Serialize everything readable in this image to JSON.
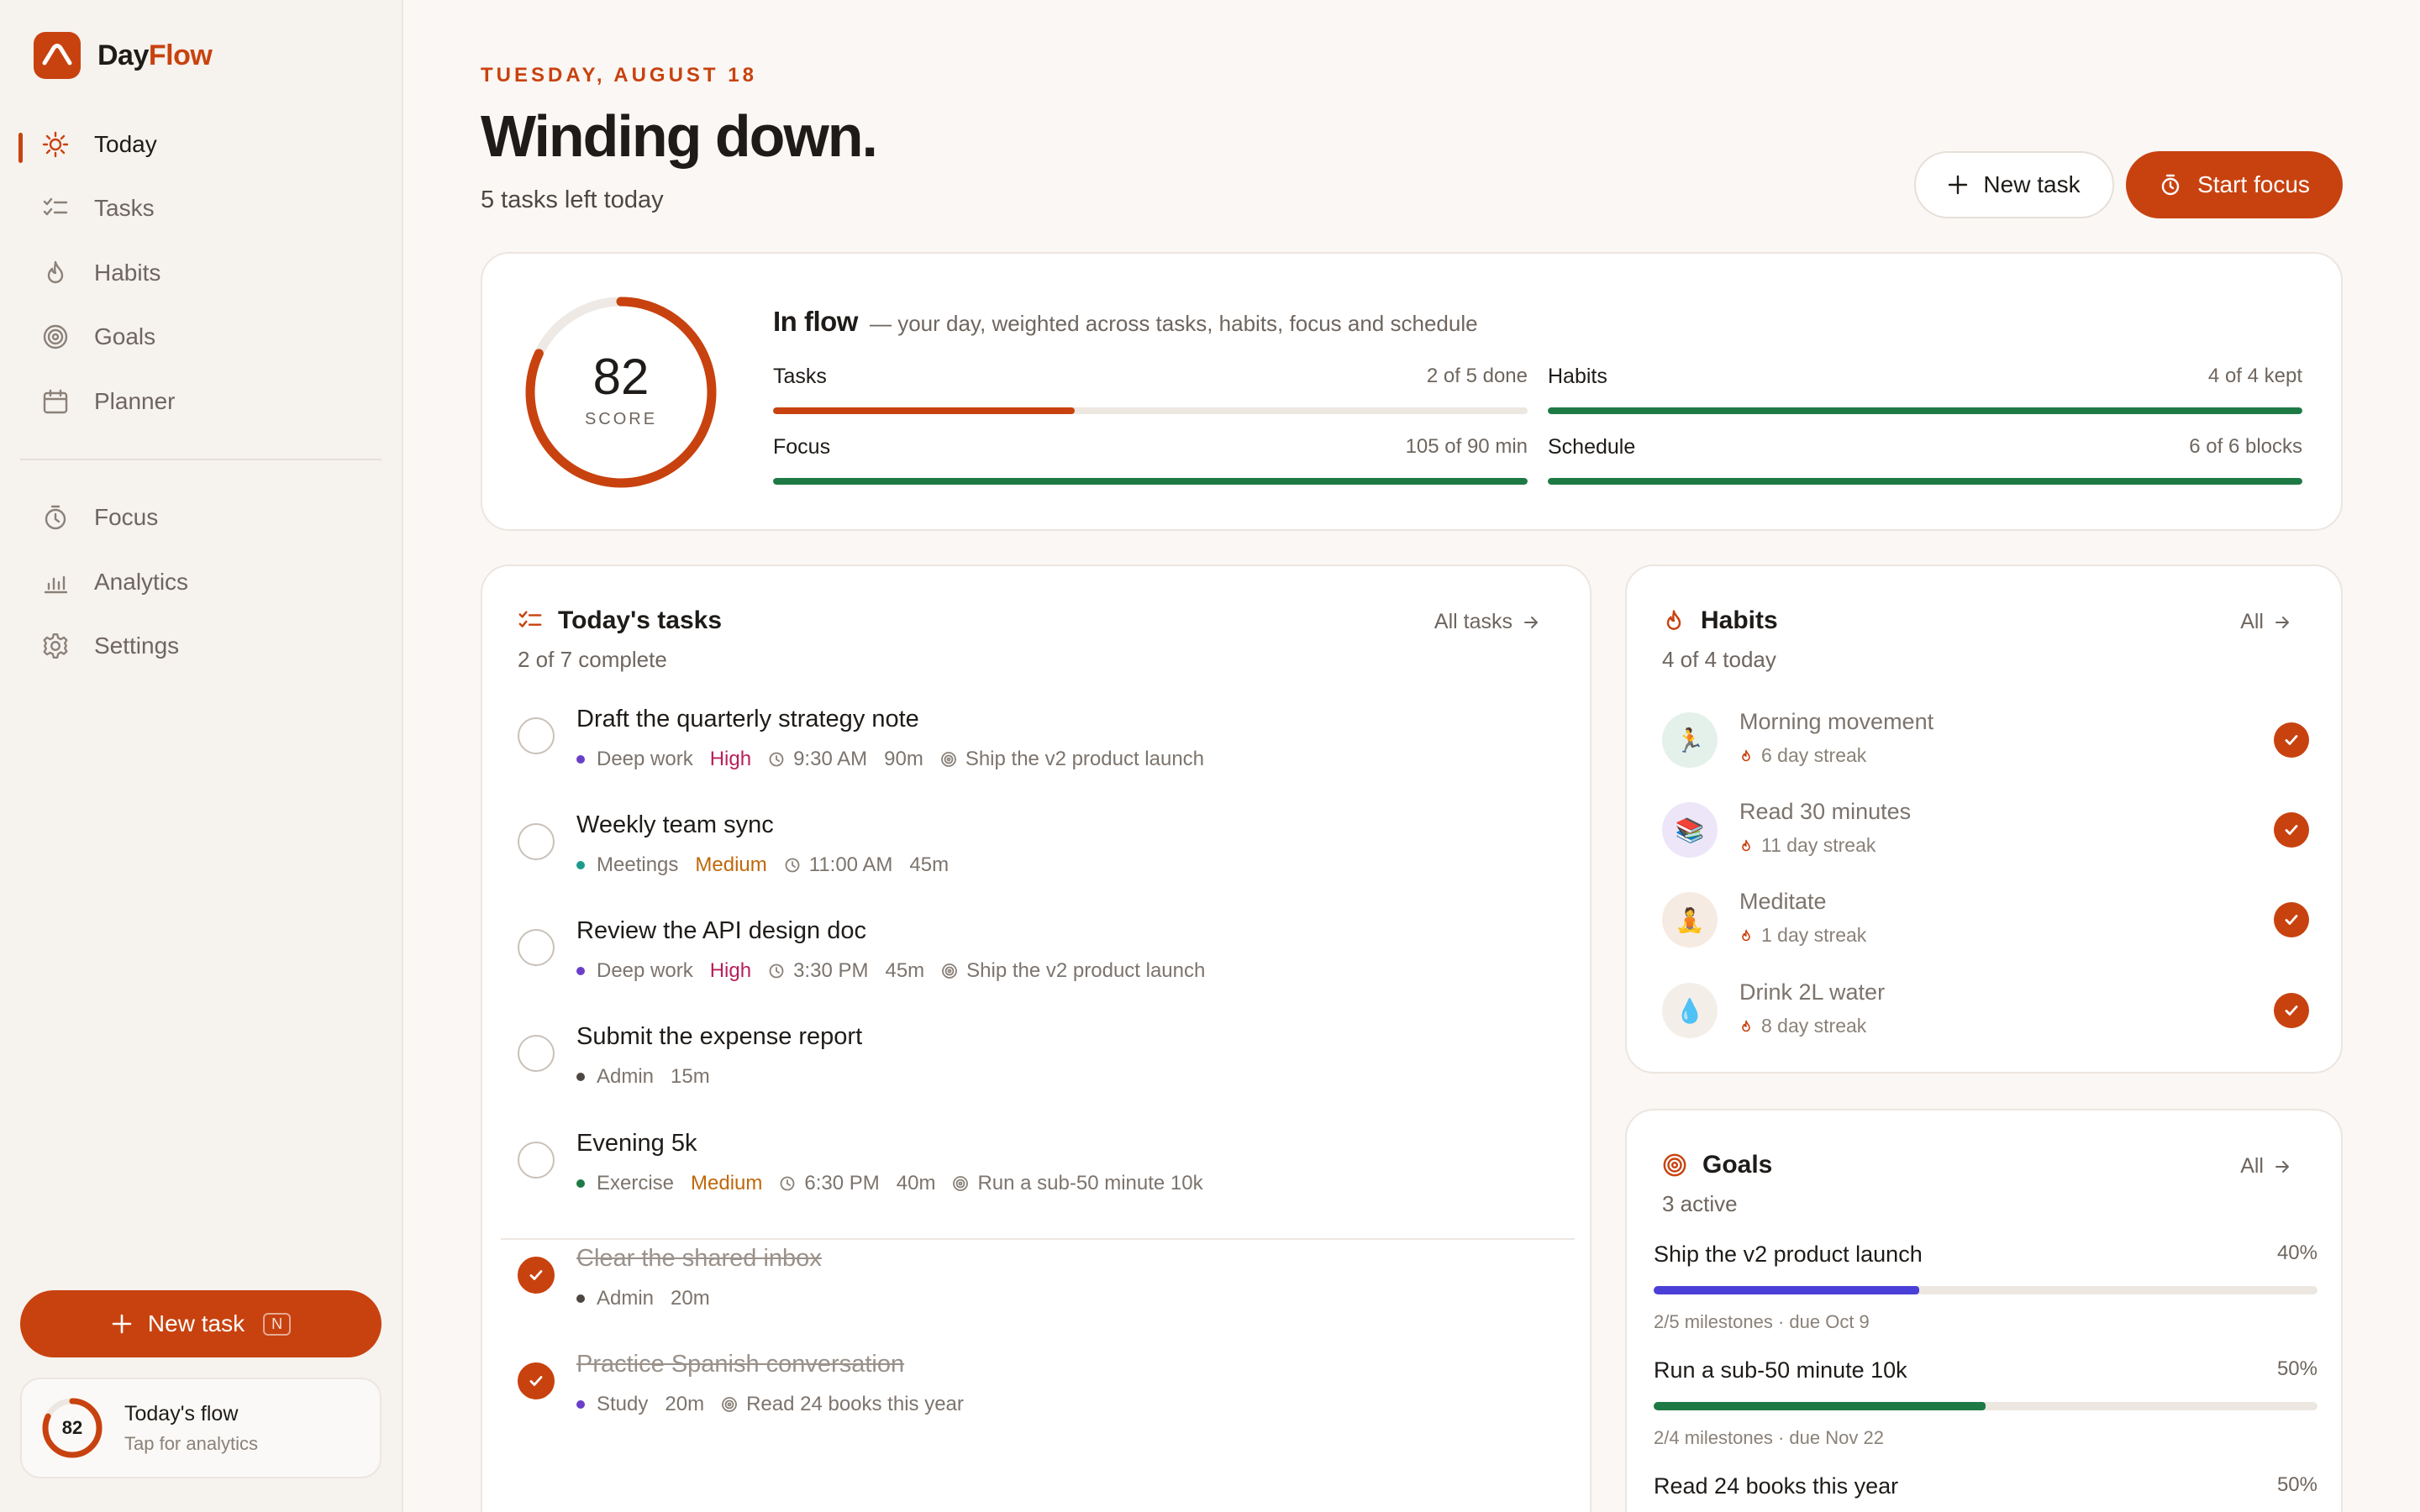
{
  "app": {
    "name_prefix": "Day",
    "name_accent": "Flow",
    "accent_color": "#C8420F"
  },
  "sidebar": {
    "nav": [
      {
        "label": "Today",
        "icon": "sun-icon",
        "active": true
      },
      {
        "label": "Tasks",
        "icon": "checklist-icon",
        "active": false
      },
      {
        "label": "Habits",
        "icon": "flame-icon",
        "active": false
      },
      {
        "label": "Goals",
        "icon": "target-icon",
        "active": false
      },
      {
        "label": "Planner",
        "icon": "calendar-icon",
        "active": false
      }
    ],
    "nav2": [
      {
        "label": "Focus",
        "icon": "timer-icon"
      },
      {
        "label": "Analytics",
        "icon": "bar-chart-icon"
      },
      {
        "label": "Settings",
        "icon": "gear-icon"
      }
    ],
    "new_task_label": "New task",
    "new_task_shortcut": "N",
    "flow_card": {
      "score": "82",
      "progress": 0.82,
      "title": "Today's flow",
      "subtitle": "Tap for analytics"
    }
  },
  "header": {
    "date": "TUESDAY, AUGUST 18",
    "title": "Winding down.",
    "subtitle": "5 tasks left today",
    "new_task_label": "New task",
    "start_focus_label": "Start focus"
  },
  "score": {
    "value": "82",
    "progress": 0.82,
    "label": "SCORE",
    "title": "In flow",
    "description": "— your day, weighted across tasks, habits, focus and schedule",
    "metrics": [
      {
        "name": "Tasks",
        "value": "2 of 5 done",
        "progress": 0.4,
        "color": "#C8420F"
      },
      {
        "name": "Habits",
        "value": "4 of 4 kept",
        "progress": 1.0,
        "color": "#1E7A45"
      },
      {
        "name": "Focus",
        "value": "105 of 90 min",
        "progress": 1.0,
        "color": "#1E7A45"
      },
      {
        "name": "Schedule",
        "value": "6 of 6 blocks",
        "progress": 1.0,
        "color": "#1E7A45"
      }
    ]
  },
  "tasks_card": {
    "title": "Today's tasks",
    "subtitle": "2 of 7 complete",
    "link": "All tasks",
    "tasks": [
      {
        "title": "Draft the quarterly strategy note",
        "category": "Deep work",
        "category_color": "#6A3FC8",
        "priority": "High",
        "time": "9:30 AM",
        "duration": "90m",
        "goal": "Ship the v2 product launch",
        "done": false
      },
      {
        "title": "Weekly team sync",
        "category": "Meetings",
        "category_color": "#1B9C8E",
        "priority": "Medium",
        "time": "11:00 AM",
        "duration": "45m",
        "goal": "",
        "done": false
      },
      {
        "title": "Review the API design doc",
        "category": "Deep work",
        "category_color": "#6A3FC8",
        "priority": "High",
        "time": "3:30 PM",
        "duration": "45m",
        "goal": "Ship the v2 product launch",
        "done": false
      },
      {
        "title": "Submit the expense report",
        "category": "Admin",
        "category_color": "#4E4741",
        "priority": "",
        "time": "",
        "duration": "15m",
        "goal": "",
        "done": false
      },
      {
        "title": "Evening 5k",
        "category": "Exercise",
        "category_color": "#1E7A45",
        "priority": "Medium",
        "time": "6:30 PM",
        "duration": "40m",
        "goal": "Run a sub-50 minute 10k",
        "done": false
      },
      {
        "title": "Clear the shared inbox",
        "category": "Admin",
        "category_color": "#4E4741",
        "priority": "",
        "time": "",
        "duration": "20m",
        "goal": "",
        "done": true
      },
      {
        "title": "Practice Spanish conversation",
        "category": "Study",
        "category_color": "#6A3FC8",
        "priority": "",
        "time": "",
        "duration": "20m",
        "goal": "Read 24 books this year",
        "done": true
      }
    ]
  },
  "habits_card": {
    "title": "Habits",
    "subtitle": "4 of 4 today",
    "link": "All",
    "habits": [
      {
        "name": "Morning movement",
        "streak": "6 day streak",
        "emoji": "🏃",
        "bg": "#E4F1EA"
      },
      {
        "name": "Read 30 minutes",
        "streak": "11 day streak",
        "emoji": "📚",
        "bg": "#ECE6F8"
      },
      {
        "name": "Meditate",
        "streak": "1 day streak",
        "emoji": "🧘",
        "bg": "#F6EBE2"
      },
      {
        "name": "Drink 2L water",
        "streak": "8 day streak",
        "emoji": "💧",
        "bg": "#F4EEE9"
      }
    ]
  },
  "goals_card": {
    "title": "Goals",
    "subtitle": "3 active",
    "link": "All",
    "goals": [
      {
        "name": "Ship the v2 product launch",
        "pct": "40%",
        "progress": 0.4,
        "color": "#4A3FD6",
        "meta": "2/5 milestones · due Oct 9"
      },
      {
        "name": "Run a sub-50 minute 10k",
        "pct": "50%",
        "progress": 0.5,
        "color": "#1E7A45",
        "meta": "2/4 milestones · due Nov 22"
      },
      {
        "name": "Read 24 books this year",
        "pct": "50%",
        "progress": 0.5,
        "color": "#C8420F",
        "meta": ""
      }
    ]
  }
}
